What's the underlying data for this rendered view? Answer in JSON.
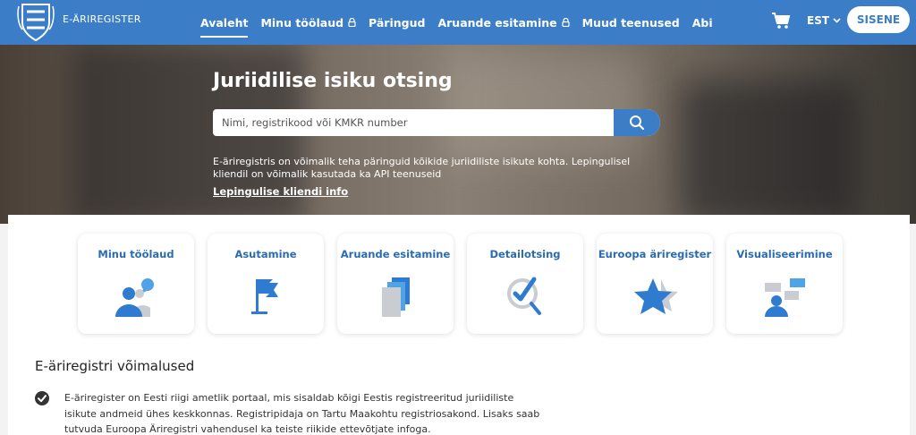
{
  "header": {
    "brand": "E-ÄRIREGISTER",
    "nav": [
      {
        "label": "Avaleht",
        "active": true,
        "locked": false
      },
      {
        "label": "Minu töölaud",
        "active": false,
        "locked": true
      },
      {
        "label": "Päringud",
        "active": false,
        "locked": false
      },
      {
        "label": "Aruande esitamine",
        "active": false,
        "locked": true
      },
      {
        "label": "Muud teenused",
        "active": false,
        "locked": false
      },
      {
        "label": "Abi",
        "active": false,
        "locked": false
      }
    ],
    "language": "EST",
    "login_label": "SISENE",
    "cart_icon": "cart-icon"
  },
  "hero": {
    "title": "Juriidilise isiku otsing",
    "search_placeholder": "Nimi, registrikood või KMKR number",
    "search_value": "",
    "description": "E-äriregistris on võimalik teha päringuid kõikide juriidiliste isikute kohta. Lepingulisel kliendil on võimalik kasutada ka API teenuseid",
    "link": "Lepingulise kliendi info"
  },
  "cards": [
    {
      "label": "Minu töölaud",
      "icon": "person-chat-icon"
    },
    {
      "label": "Asutamine",
      "icon": "flag-icon"
    },
    {
      "label": "Aruande esitamine",
      "icon": "documents-icon"
    },
    {
      "label": "Detailotsing",
      "icon": "magnifier-check-icon"
    },
    {
      "label": "Euroopa äriregister",
      "icon": "star-icon"
    },
    {
      "label": "Visualiseerimine",
      "icon": "person-diagram-icon"
    }
  ],
  "section": {
    "title": "E-äriregistri võimalused",
    "items": [
      "E-äriregister on Eesti riigi ametlik portaal, mis sisaldab kõigi Eestis registreeritud juriidiliste isikute andmeid ühes keskkonnas. Registripidaja on Tartu Maakohtu registriosakond. Lisaks saab tutvuda Euroopa Äriregistri vahendusel ka teiste riikide ettevõtjate infoga."
    ]
  },
  "colors": {
    "brand_blue": "#3b7ec7",
    "card_title": "#2b6cb0",
    "icon_light_blue": "#4fa3e6",
    "icon_gray": "#c9ccd1"
  }
}
